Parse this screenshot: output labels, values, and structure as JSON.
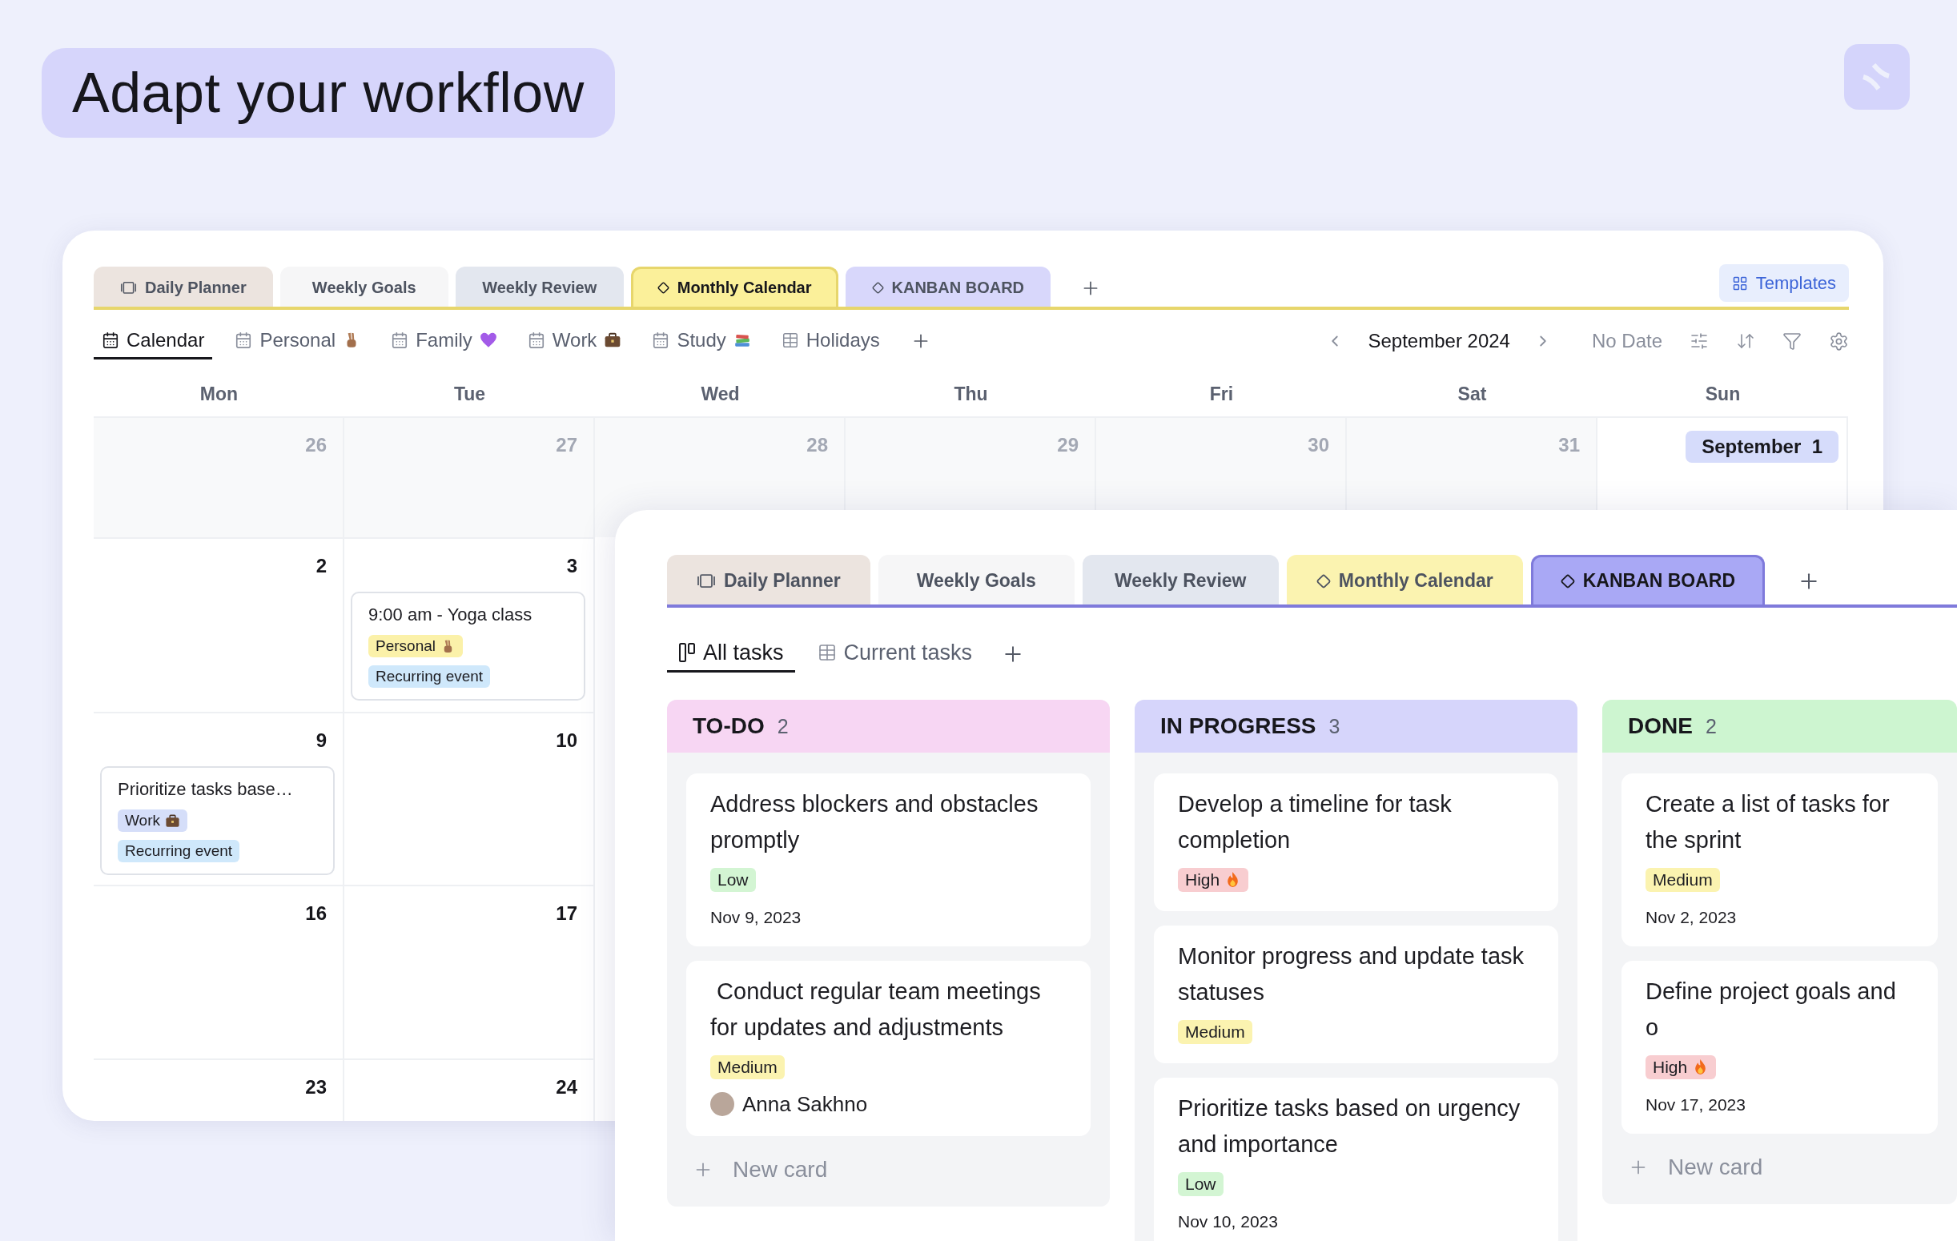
{
  "headline": "Adapt your workflow",
  "calendar_window": {
    "tabs": [
      {
        "label": "Daily Planner",
        "kind": "panel",
        "color": "#ece4df",
        "selected": false
      },
      {
        "label": "Weekly Goals",
        "kind": "plain",
        "color": "#f6f6f7",
        "selected": false
      },
      {
        "label": "Weekly Review",
        "kind": "plain",
        "color": "#e3e7ef",
        "selected": false
      },
      {
        "label": "Monthly Calendar",
        "kind": "diamond",
        "color": "#fbf09a",
        "selected": true
      },
      {
        "label": "KANBAN BOARD",
        "kind": "diamond",
        "color": "#d8d7fb",
        "selected": false
      }
    ],
    "templates_button": "Templates",
    "views": [
      {
        "label": "Calendar",
        "kind": "calendar",
        "selected": true
      },
      {
        "label": "Personal",
        "kind": "calendar-hand",
        "selected": false
      },
      {
        "label": "Family",
        "kind": "calendar-heart",
        "selected": false
      },
      {
        "label": "Work",
        "kind": "calendar-case",
        "selected": false
      },
      {
        "label": "Study",
        "kind": "calendar-books",
        "selected": false
      },
      {
        "label": "Holidays",
        "kind": "table",
        "selected": false
      }
    ],
    "month": "September 2024",
    "no_date": "No Date",
    "weekdays": [
      "Mon",
      "Tue",
      "Wed",
      "Thu",
      "Fri",
      "Sat",
      "Sun"
    ],
    "weeks": [
      {
        "days": [
          {
            "label": "26",
            "muted": true,
            "highlighted": false
          },
          {
            "label": "27",
            "muted": true,
            "highlighted": false
          },
          {
            "label": "28",
            "muted": true,
            "highlighted": false
          },
          {
            "label": "29",
            "muted": true,
            "highlighted": false
          },
          {
            "label": "30",
            "muted": true,
            "highlighted": false
          },
          {
            "label": "31",
            "muted": true,
            "highlighted": false
          },
          {
            "label": "September  1",
            "muted": false,
            "highlighted": true
          }
        ]
      },
      {
        "days": [
          {
            "label": "2",
            "muted": false,
            "highlighted": false
          },
          {
            "label": "3",
            "muted": false,
            "highlighted": false,
            "events": [
              {
                "title": "9:00 am - Yoga class",
                "tags": [
                  {
                    "text": "Personal",
                    "color": "#fbf1a9",
                    "kind": "hand"
                  },
                  {
                    "text": "Recurring event",
                    "color": "#cfe8fb"
                  }
                ]
              }
            ]
          }
        ]
      },
      {
        "days": [
          {
            "label": "9",
            "muted": false,
            "highlighted": false,
            "events": [
              {
                "title": "Prioritize tasks base…",
                "tags": [
                  {
                    "text": "Work",
                    "color": "#d5def9",
                    "kind": "case"
                  },
                  {
                    "text": "Recurring event",
                    "color": "#cfe8fb"
                  }
                ]
              }
            ]
          },
          {
            "label": "10",
            "muted": false,
            "highlighted": false
          }
        ]
      },
      {
        "days": [
          {
            "label": "16",
            "muted": false,
            "highlighted": false
          },
          {
            "label": "17",
            "muted": false,
            "highlighted": false
          }
        ]
      },
      {
        "days": [
          {
            "label": "23",
            "muted": false,
            "highlighted": false
          },
          {
            "label": "24",
            "muted": false,
            "highlighted": false
          }
        ]
      }
    ]
  },
  "board_window": {
    "tabs": [
      {
        "label": "Daily Planner",
        "kind": "panel",
        "color": "#ece4df",
        "selected": false
      },
      {
        "label": "Weekly Goals",
        "kind": "plain",
        "color": "#f6f6f7",
        "selected": false
      },
      {
        "label": "Weekly Review",
        "kind": "plain",
        "color": "#e3e7ef",
        "selected": false
      },
      {
        "label": "Monthly Calendar",
        "kind": "diamond",
        "color": "#fbf3b0",
        "selected": false
      },
      {
        "label": "KANBAN BOARD",
        "kind": "diamond",
        "color": "#a9a8f5",
        "selected": true
      }
    ],
    "views": [
      {
        "label": "All tasks",
        "kind": "board",
        "selected": true
      },
      {
        "label": "Current tasks",
        "kind": "table",
        "selected": false
      }
    ],
    "columns": [
      {
        "title": "TO-DO",
        "count": "2",
        "color": "#f7d6f3",
        "cards": [
          {
            "title": "Address blockers and obstacles promptly",
            "priority": {
              "text": "Low",
              "color": "#d3f5d3"
            },
            "date": "Nov 9, 2023"
          },
          {
            "title": " Conduct regular team meetings for updates and adjustments",
            "priority": {
              "text": "Medium",
              "color": "#fbf3b0"
            },
            "assignee": "Anna Sakhno"
          }
        ],
        "new_card": "New card"
      },
      {
        "title": "IN PROGRESS",
        "count": "3",
        "color": "#d6d5fb",
        "cards": [
          {
            "title": "Develop a timeline for task completion",
            "priority": {
              "text": "High",
              "color": "#f8cdd0",
              "kind": "fire"
            }
          },
          {
            "title": "Monitor progress and update task statuses",
            "priority": {
              "text": "Medium",
              "color": "#fbf3b0"
            }
          },
          {
            "title": "Prioritize tasks based on urgency and importance",
            "priority": {
              "text": "Low",
              "color": "#d3f5d3"
            },
            "date": "Nov 10, 2023"
          }
        ]
      },
      {
        "title": "DONE",
        "count": "2",
        "color": "#cdf5d0",
        "cards": [
          {
            "title": "Create a list of tasks for the sprint",
            "priority": {
              "text": "Medium",
              "color": "#fbf3b0"
            },
            "date": "Nov 2, 2023"
          },
          {
            "title": "Define project goals and o",
            "priority": {
              "text": "High",
              "color": "#f8cdd0",
              "kind": "fire"
            },
            "date": "Nov 17, 2023"
          }
        ],
        "new_card": "New card"
      }
    ]
  }
}
